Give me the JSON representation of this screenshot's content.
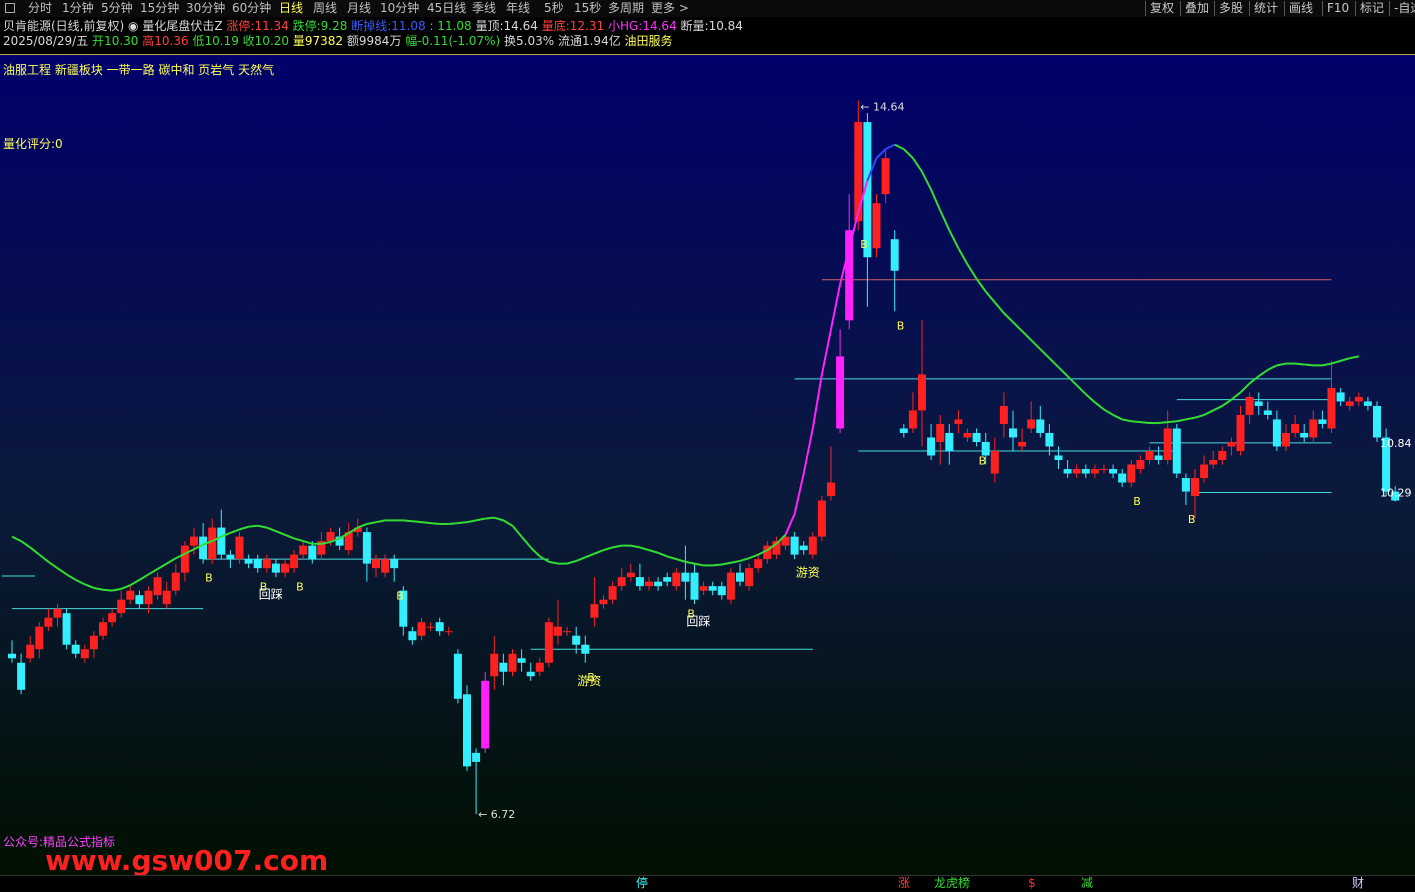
{
  "toolbar": {
    "tabs": [
      "分时",
      "1分钟",
      "5分钟",
      "15分钟",
      "30分钟",
      "60分钟",
      "日线",
      "周线",
      "月线",
      "10分钟",
      "45日线",
      "季线",
      "年线",
      "5秒",
      "15秒",
      "多周期",
      "更多 >"
    ],
    "active": "日线",
    "right_buttons": [
      "复权",
      "叠加",
      "多股",
      "统计",
      "画线",
      "F10",
      "标记",
      "-自选"
    ],
    "right_icons": [
      "diamond-icon",
      "close-icon"
    ]
  },
  "header": {
    "stock": "贝肯能源(日线,前复权)",
    "indicator": "量化尾盘伏击Z",
    "zt_label": "涨停:",
    "zt_value": "11.34",
    "dt_label": "跌停:",
    "dt_value": "9.28",
    "jj_label": "断掉线:",
    "jj_value": "11.08",
    "jj_value2": ": 11.08",
    "ld_label": "量顶:",
    "ld_value": "14.64",
    "ldi_label": "量底:",
    "ldi_value": "12.31",
    "xhg_label": "小HG:",
    "xhg_value": "14.64",
    "dl_label": "断量:",
    "dl_value": "10.84",
    "date": "2025/08/29/五",
    "open_label": "开",
    "open": "10.30",
    "high_label": "高",
    "high": "10.36",
    "low_label": "低",
    "low": "10.19",
    "close_label": "收",
    "close": "10.20",
    "vol_label": "量",
    "vol": "97382",
    "amt_label": "额",
    "amt": "9984万",
    "chg_label": "幅",
    "chg": "-0.11(-1.07%)",
    "turn_label": "换",
    "turn": "5.03%",
    "float_label": "流通",
    "float": "1.94亿",
    "industry": "油田服务"
  },
  "overlay": {
    "concepts": "油服工程 新疆板块 一带一路 碳中和 页岩气 天然气",
    "score": "量化评分:0",
    "watermark_small": "公众号:精品公式指标",
    "watermark_big": "www.gsw007.com"
  },
  "colors": {
    "up": "#ff2020",
    "down": "#33eeff",
    "limit_up": "#ff22ff",
    "ma": "#33dd33",
    "ma_rise": "#ff22ff",
    "ma_blue": "#3344ff",
    "support": "#44dddd",
    "resist": "#d06060",
    "bg_top": "#00006a",
    "bg_bottom": "#001000"
  },
  "bottom_tags": [
    "停",
    "涨",
    "龙虎榜",
    "$",
    "减",
    "财"
  ],
  "chart_data": {
    "type": "candlestick",
    "ylim": [
      6.2,
      15.1
    ],
    "high_label": "14.64",
    "low_label": "6.72",
    "right_labels": [
      "10.84",
      "10.29"
    ],
    "candles": [
      [
        8.5,
        8.45,
        8.65,
        8.4
      ],
      [
        8.4,
        8.1,
        8.5,
        8.05
      ],
      [
        8.45,
        8.6,
        8.7,
        8.4
      ],
      [
        8.55,
        8.8,
        8.85,
        8.45
      ],
      [
        8.8,
        8.9,
        9.0,
        8.75
      ],
      [
        8.9,
        9.0,
        9.05,
        8.8
      ],
      [
        8.95,
        8.6,
        9.0,
        8.55
      ],
      [
        8.6,
        8.5,
        8.65,
        8.45
      ],
      [
        8.45,
        8.55,
        8.6,
        8.4
      ],
      [
        8.55,
        8.7,
        8.75,
        8.45
      ],
      [
        8.7,
        8.85,
        8.9,
        8.65
      ],
      [
        8.85,
        8.95,
        9.0,
        8.8
      ],
      [
        8.95,
        9.1,
        9.2,
        8.9
      ],
      [
        9.1,
        9.2,
        9.25,
        9.05
      ],
      [
        9.15,
        9.05,
        9.2,
        9.0
      ],
      [
        9.05,
        9.2,
        9.25,
        8.95
      ],
      [
        9.15,
        9.35,
        9.4,
        9.1
      ],
      [
        9.05,
        9.2,
        9.3,
        9.0
      ],
      [
        9.2,
        9.4,
        9.5,
        9.15
      ],
      [
        9.4,
        9.7,
        9.75,
        9.3
      ],
      [
        9.7,
        9.8,
        9.9,
        9.6
      ],
      [
        9.8,
        9.55,
        9.95,
        9.5
      ],
      [
        9.55,
        9.9,
        10.0,
        9.5
      ],
      [
        9.9,
        9.6,
        10.1,
        9.55
      ],
      [
        9.6,
        9.55,
        9.65,
        9.45
      ],
      [
        9.55,
        9.8,
        9.85,
        9.5
      ],
      [
        9.55,
        9.5,
        9.6,
        9.45
      ],
      [
        9.55,
        9.45,
        9.6,
        9.4
      ],
      [
        9.45,
        9.55,
        9.6,
        9.4
      ],
      [
        9.5,
        9.4,
        9.55,
        9.35
      ],
      [
        9.4,
        9.5,
        9.55,
        9.35
      ],
      [
        9.45,
        9.6,
        9.65,
        9.4
      ],
      [
        9.6,
        9.7,
        9.75,
        9.55
      ],
      [
        9.7,
        9.55,
        9.75,
        9.5
      ],
      [
        9.6,
        9.75,
        9.85,
        9.55
      ],
      [
        9.75,
        9.85,
        9.9,
        9.7
      ],
      [
        9.8,
        9.7,
        9.9,
        9.65
      ],
      [
        9.65,
        9.85,
        9.95,
        9.6
      ],
      [
        9.85,
        9.9,
        10.0,
        9.8
      ],
      [
        9.85,
        9.5,
        9.9,
        9.3
      ],
      [
        9.45,
        9.55,
        9.6,
        9.35
      ],
      [
        9.4,
        9.55,
        9.6,
        9.35
      ],
      [
        9.55,
        9.45,
        9.6,
        9.3
      ],
      [
        9.2,
        8.8,
        9.25,
        8.7
      ],
      [
        8.75,
        8.65,
        8.8,
        8.6
      ],
      [
        8.7,
        8.85,
        8.9,
        8.65
      ],
      [
        8.8,
        8.8,
        8.85,
        8.75
      ],
      [
        8.85,
        8.75,
        8.9,
        8.7
      ],
      [
        8.75,
        8.75,
        8.8,
        8.7
      ],
      [
        8.5,
        8.0,
        8.55,
        7.95
      ],
      [
        8.05,
        7.25,
        8.15,
        7.2
      ],
      [
        7.4,
        7.3,
        7.45,
        6.72
      ],
      [
        7.45,
        8.2,
        8.3,
        7.4
      ],
      [
        8.25,
        8.5,
        8.7,
        8.1
      ],
      [
        8.4,
        8.3,
        8.5,
        8.15
      ],
      [
        8.3,
        8.5,
        8.55,
        8.25
      ],
      [
        8.45,
        8.4,
        8.55,
        8.3
      ],
      [
        8.3,
        8.25,
        8.4,
        8.2
      ],
      [
        8.3,
        8.4,
        8.45,
        8.25
      ],
      [
        8.4,
        8.85,
        8.9,
        8.35
      ],
      [
        8.7,
        8.8,
        9.1,
        8.6
      ],
      [
        8.75,
        8.75,
        8.8,
        8.7
      ],
      [
        8.7,
        8.6,
        8.8,
        8.5
      ],
      [
        8.6,
        8.5,
        8.7,
        8.4
      ],
      [
        8.9,
        9.05,
        9.35,
        8.8
      ],
      [
        9.05,
        9.1,
        9.15,
        9.0
      ],
      [
        9.1,
        9.25,
        9.3,
        9.05
      ],
      [
        9.25,
        9.35,
        9.45,
        9.2
      ],
      [
        9.35,
        9.4,
        9.5,
        9.3
      ],
      [
        9.35,
        9.25,
        9.5,
        9.2
      ],
      [
        9.25,
        9.3,
        9.35,
        9.2
      ],
      [
        9.3,
        9.25,
        9.35,
        9.2
      ],
      [
        9.35,
        9.3,
        9.4,
        9.25
      ],
      [
        9.25,
        9.4,
        9.45,
        9.2
      ],
      [
        9.4,
        9.3,
        9.7,
        9.1
      ],
      [
        9.4,
        9.1,
        9.5,
        9.05
      ],
      [
        9.2,
        9.25,
        9.3,
        9.15
      ],
      [
        9.25,
        9.2,
        9.3,
        9.15
      ],
      [
        9.25,
        9.15,
        9.3,
        9.1
      ],
      [
        9.1,
        9.4,
        9.45,
        9.05
      ],
      [
        9.4,
        9.3,
        9.5,
        9.25
      ],
      [
        9.25,
        9.45,
        9.5,
        9.2
      ],
      [
        9.45,
        9.55,
        9.6,
        9.4
      ],
      [
        9.55,
        9.7,
        9.75,
        9.5
      ],
      [
        9.6,
        9.75,
        9.8,
        9.55
      ],
      [
        9.7,
        9.8,
        9.85,
        9.65
      ],
      [
        9.8,
        9.6,
        9.85,
        9.55
      ],
      [
        9.7,
        9.65,
        9.75,
        9.6
      ],
      [
        9.6,
        9.8,
        9.85,
        9.55
      ],
      [
        9.8,
        10.2,
        10.25,
        9.75
      ],
      [
        10.25,
        10.4,
        10.8,
        10.2
      ],
      [
        11.0,
        11.8,
        12.1,
        10.95
      ],
      [
        12.2,
        13.2,
        13.6,
        12.1
      ],
      [
        13.3,
        14.4,
        14.64,
        13.2
      ],
      [
        14.4,
        12.9,
        14.5,
        12.35
      ],
      [
        13.0,
        13.5,
        13.6,
        12.9
      ],
      [
        13.6,
        14.0,
        14.1,
        13.5
      ],
      [
        13.1,
        12.75,
        13.2,
        12.3
      ],
      [
        11.0,
        10.95,
        11.05,
        10.9
      ],
      [
        11.0,
        11.2,
        11.4,
        10.95
      ],
      [
        11.2,
        11.6,
        12.2,
        10.8
      ],
      [
        10.9,
        10.7,
        11.05,
        10.65
      ],
      [
        10.85,
        11.05,
        11.15,
        10.6
      ],
      [
        10.95,
        10.75,
        11.05,
        10.6
      ],
      [
        11.05,
        11.1,
        11.2,
        10.95
      ],
      [
        10.9,
        10.95,
        11.0,
        10.85
      ],
      [
        10.95,
        10.85,
        11.0,
        10.8
      ],
      [
        10.85,
        10.7,
        10.95,
        10.6
      ],
      [
        10.5,
        10.75,
        10.9,
        10.4
      ],
      [
        11.05,
        11.25,
        11.4,
        10.9
      ],
      [
        11.0,
        10.9,
        11.2,
        10.75
      ],
      [
        10.8,
        10.85,
        11.0,
        10.75
      ],
      [
        11.0,
        11.1,
        11.3,
        10.95
      ],
      [
        11.1,
        10.95,
        11.25,
        10.9
      ],
      [
        10.95,
        10.8,
        11.05,
        10.7
      ],
      [
        10.7,
        10.65,
        10.8,
        10.55
      ],
      [
        10.55,
        10.5,
        10.65,
        10.45
      ],
      [
        10.5,
        10.55,
        10.6,
        10.45
      ],
      [
        10.55,
        10.5,
        10.6,
        10.45
      ],
      [
        10.5,
        10.55,
        10.6,
        10.45
      ],
      [
        10.55,
        10.55,
        10.6,
        10.5
      ],
      [
        10.55,
        10.5,
        10.6,
        10.45
      ],
      [
        10.5,
        10.4,
        10.55,
        10.35
      ],
      [
        10.4,
        10.6,
        10.65,
        10.35
      ],
      [
        10.55,
        10.65,
        10.7,
        10.5
      ],
      [
        10.65,
        10.75,
        10.8,
        10.6
      ],
      [
        10.7,
        10.65,
        10.8,
        10.6
      ],
      [
        10.65,
        11.0,
        11.2,
        10.6
      ],
      [
        11.0,
        10.5,
        11.05,
        10.45
      ],
      [
        10.45,
        10.3,
        10.5,
        10.15
      ],
      [
        10.25,
        10.45,
        10.55,
        10.0
      ],
      [
        10.45,
        10.6,
        10.7,
        10.4
      ],
      [
        10.6,
        10.65,
        10.75,
        10.55
      ],
      [
        10.65,
        10.75,
        10.8,
        10.6
      ],
      [
        10.8,
        10.85,
        10.9,
        10.7
      ],
      [
        10.75,
        11.15,
        11.25,
        10.7
      ],
      [
        11.15,
        11.35,
        11.4,
        11.05
      ],
      [
        11.3,
        11.25,
        11.4,
        11.15
      ],
      [
        11.2,
        11.15,
        11.3,
        11.1
      ],
      [
        11.1,
        10.8,
        11.2,
        10.75
      ],
      [
        10.8,
        10.95,
        11.05,
        10.75
      ],
      [
        10.95,
        11.05,
        11.15,
        10.9
      ],
      [
        10.95,
        10.9,
        11.05,
        10.85
      ],
      [
        10.9,
        11.1,
        11.2,
        10.85
      ],
      [
        11.1,
        11.05,
        11.2,
        11.0
      ],
      [
        11.0,
        11.45,
        11.75,
        10.95
      ],
      [
        11.4,
        11.3,
        11.45,
        11.25
      ],
      [
        11.25,
        11.3,
        11.35,
        11.2
      ],
      [
        11.3,
        11.35,
        11.4,
        11.25
      ],
      [
        11.3,
        11.25,
        11.35,
        11.2
      ],
      [
        11.25,
        10.9,
        11.3,
        10.85
      ],
      [
        10.9,
        10.3,
        11.0,
        10.25
      ],
      [
        10.3,
        10.2,
        10.36,
        10.19
      ]
    ],
    "ma": [
      9.8,
      9.75,
      9.68,
      9.6,
      9.52,
      9.45,
      9.38,
      9.32,
      9.27,
      9.23,
      9.21,
      9.2,
      9.22,
      9.26,
      9.32,
      9.38,
      9.44,
      9.5,
      9.56,
      9.61,
      9.66,
      9.71,
      9.75,
      9.8,
      9.84,
      9.88,
      9.91,
      9.92,
      9.9,
      9.86,
      9.82,
      9.78,
      9.75,
      9.72,
      9.72,
      9.74,
      9.78,
      9.84,
      9.9,
      9.94,
      9.96,
      9.98,
      9.98,
      9.98,
      9.97,
      9.96,
      9.95,
      9.94,
      9.94,
      9.95,
      9.96,
      9.98,
      10.0,
      10.01,
      9.98,
      9.92,
      9.8,
      9.68,
      9.58,
      9.52,
      9.5,
      9.5,
      9.53,
      9.57,
      9.61,
      9.65,
      9.68,
      9.7,
      9.7,
      9.68,
      9.65,
      9.62,
      9.58,
      9.55,
      9.52,
      9.5,
      9.48,
      9.48,
      9.49,
      9.51,
      9.53,
      9.56,
      9.6,
      9.65,
      9.72,
      9.82,
      10.05,
      10.5,
      11.0,
      11.6,
      12.1,
      12.6,
      13.0,
      13.4,
      13.75,
      14.0,
      14.1,
      14.15,
      14.1,
      14.0,
      13.85,
      13.65,
      13.42,
      13.2,
      13.0,
      12.82,
      12.66,
      12.52,
      12.4,
      12.28,
      12.18,
      12.08,
      11.98,
      11.88,
      11.78,
      11.68,
      11.58,
      11.48,
      11.38,
      11.29,
      11.21,
      11.15,
      11.1,
      11.08,
      11.07,
      11.06,
      11.06,
      11.07,
      11.08,
      11.1,
      11.12,
      11.15,
      11.2,
      11.25,
      11.32,
      11.4,
      11.5,
      11.58,
      11.65,
      11.7,
      11.72,
      11.72,
      11.71,
      11.7,
      11.7,
      11.72,
      11.75,
      11.78,
      11.8
    ]
  },
  "signals": {
    "B": [
      21,
      27,
      31,
      42,
      63,
      74,
      93,
      97,
      106,
      123,
      129
    ],
    "回踩_positions": [
      27,
      74
    ],
    "游资_positions": [
      63,
      87
    ],
    "回踩_label": "回踩",
    "游资_label": "游资",
    "B_label": "B"
  },
  "levels": [
    {
      "price": 9.0,
      "from": 0,
      "to": 21,
      "color": "support"
    },
    {
      "price": 9.55,
      "from": 21,
      "to": 59,
      "color": "support"
    },
    {
      "price": 8.55,
      "from": 57,
      "to": 88,
      "color": "support"
    },
    {
      "price": 11.55,
      "from": 86,
      "to": 145,
      "color": "support"
    },
    {
      "price": 10.75,
      "from": 93,
      "to": 128,
      "color": "support"
    },
    {
      "price": 11.32,
      "from": 128,
      "to": 145,
      "color": "support"
    },
    {
      "price": 12.65,
      "from": 89,
      "to": 145,
      "color": "resist"
    },
    {
      "price": 10.84,
      "from": 125,
      "to": 145,
      "color": "support"
    },
    {
      "price": 10.29,
      "from": 130,
      "to": 145,
      "color": "support"
    }
  ]
}
